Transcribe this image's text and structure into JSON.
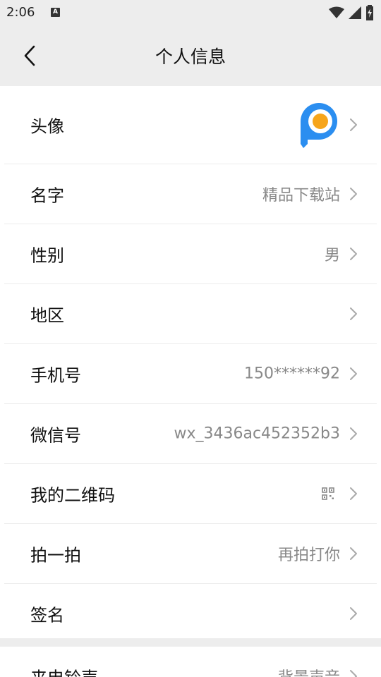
{
  "status_bar": {
    "time": "2:06",
    "notification_icon": "A"
  },
  "header": {
    "title": "个人信息"
  },
  "rows": [
    {
      "label": "头像",
      "value": "",
      "type": "avatar"
    },
    {
      "label": "名字",
      "value": "精品下载站",
      "type": "text"
    },
    {
      "label": "性别",
      "value": "男",
      "type": "text"
    },
    {
      "label": "地区",
      "value": "",
      "type": "text"
    },
    {
      "label": "手机号",
      "value": "150******92",
      "type": "text"
    },
    {
      "label": "微信号",
      "value": "wx_3436ac452352b3",
      "type": "text"
    },
    {
      "label": "我的二维码",
      "value": "",
      "type": "qr"
    },
    {
      "label": "拍一拍",
      "value": "再拍打你",
      "type": "text"
    },
    {
      "label": "签名",
      "value": "",
      "type": "text"
    }
  ],
  "bottom_row": {
    "label": "来电铃声",
    "value": "背景声音"
  },
  "colors": {
    "background": "#ededed",
    "list_bg": "#ffffff",
    "avatar_blue": "#2b8ef0",
    "avatar_orange": "#f6a51c",
    "secondary_text": "#888888"
  },
  "icons": {
    "back": "back-arrow-icon",
    "chevron": "chevron-right-icon",
    "qr": "qr-code-icon",
    "wifi": "wifi-icon",
    "signal": "signal-icon",
    "battery": "battery-icon"
  }
}
